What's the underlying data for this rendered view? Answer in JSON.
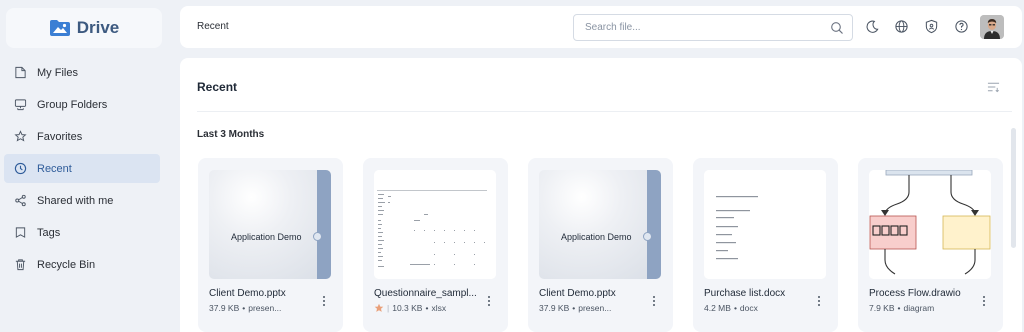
{
  "app": {
    "logo_text": "Drive"
  },
  "sidebar": {
    "items": [
      {
        "label": "My Files",
        "icon": "file-icon"
      },
      {
        "label": "Group Folders",
        "icon": "group-folder-icon"
      },
      {
        "label": "Favorites",
        "icon": "star-icon"
      },
      {
        "label": "Recent",
        "icon": "clock-icon",
        "active": true
      },
      {
        "label": "Shared with me",
        "icon": "share-icon"
      },
      {
        "label": "Tags",
        "icon": "tag-icon"
      },
      {
        "label": "Recycle Bin",
        "icon": "trash-icon"
      }
    ]
  },
  "header": {
    "breadcrumb": "Recent",
    "search": {
      "placeholder": "Search file...",
      "value": ""
    },
    "icons": [
      "moon-icon",
      "globe-icon",
      "shield-icon",
      "help-icon"
    ]
  },
  "main": {
    "title": "Recent",
    "section_title": "Last 3 Months",
    "files": [
      {
        "name": "Client Demo.pptx",
        "size": "37.9 KB",
        "sep": "•",
        "type": "presen...",
        "thumb_text": "Application Demo",
        "thumb": "pptx"
      },
      {
        "name": "Questionnaire_sampl...",
        "size": "10.3 KB",
        "sep": "•",
        "type": "xlsx",
        "thumb": "xlsx",
        "favorite": true
      },
      {
        "name": "Client Demo.pptx",
        "size": "37.9 KB",
        "sep": "•",
        "type": "presen...",
        "thumb_text": "Application Demo",
        "thumb": "pptx"
      },
      {
        "name": "Purchase list.docx",
        "size": "4.2 MB",
        "sep": "•",
        "type": "docx",
        "thumb": "docx"
      },
      {
        "name": "Process Flow.drawio",
        "size": "7.9 KB",
        "sep": "•",
        "type": "diagram",
        "thumb": "drawio"
      }
    ]
  },
  "colors": {
    "accent": "#2f5c9a",
    "active_bg": "#dbe4f2",
    "favorite": "#e9a07a"
  }
}
